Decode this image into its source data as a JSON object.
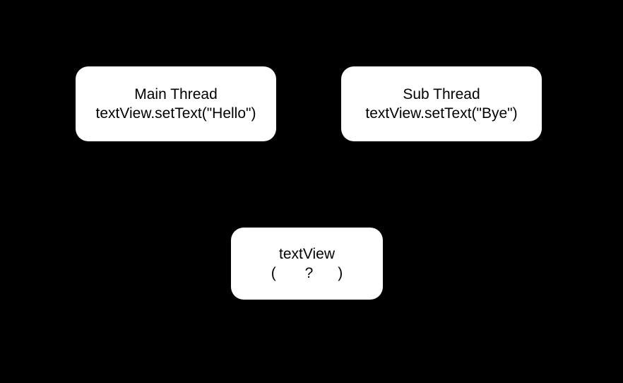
{
  "boxes": {
    "main": {
      "title": "Main Thread",
      "code": "textView.setText(\"Hello\")"
    },
    "sub": {
      "title": "Sub Thread",
      "code": "textView.setText(\"Bye\")"
    },
    "target": {
      "title": "textView",
      "value": "(       ?      )"
    }
  }
}
